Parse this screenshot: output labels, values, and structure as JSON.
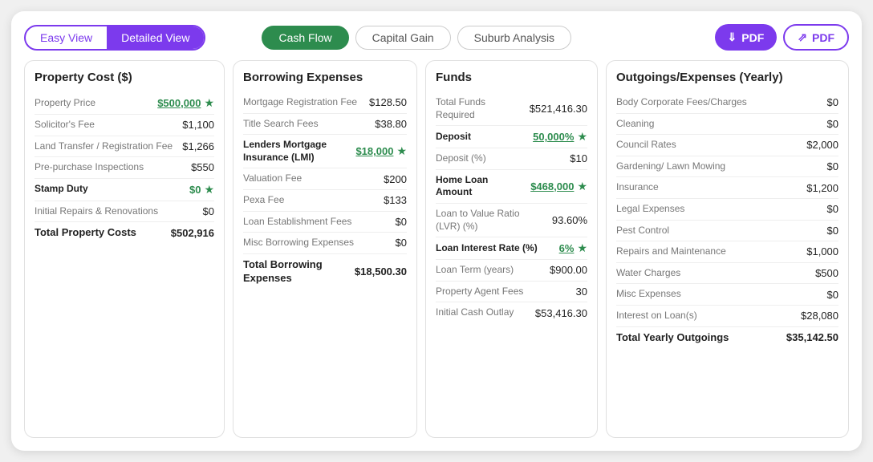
{
  "header": {
    "view_easy": "Easy View",
    "view_detailed": "Detailed View",
    "tab_cashflow": "Cash Flow",
    "tab_capital": "Capital Gain",
    "tab_suburb": "Suburb Analysis",
    "pdf_label1": "PDF",
    "pdf_label2": "PDF"
  },
  "property_cost": {
    "title": "Property Cost ($)",
    "rows": [
      {
        "label": "Property Price",
        "value": "$500,000",
        "style": "green-underline",
        "icon": "star"
      },
      {
        "label": "Solicitor's Fee",
        "value": "$1,100",
        "style": "normal",
        "icon": ""
      },
      {
        "label": "Land Transfer / Registration Fee",
        "value": "$1,266",
        "style": "normal",
        "icon": ""
      },
      {
        "label": "Pre-purchase Inspections",
        "value": "$550",
        "style": "normal",
        "icon": ""
      },
      {
        "label": "Stamp Duty",
        "value": "$0",
        "style": "green",
        "icon": "star"
      },
      {
        "label": "Initial Repairs & Renovations",
        "value": "$0",
        "style": "normal",
        "icon": ""
      }
    ],
    "total_label": "Total Property Costs",
    "total_value": "$502,916"
  },
  "borrowing": {
    "title": "Borrowing Expenses",
    "rows": [
      {
        "label": "Mortgage Registration Fee",
        "value": "$128.50",
        "style": "normal",
        "bold": false
      },
      {
        "label": "Title Search Fees",
        "value": "$38.80",
        "style": "normal",
        "bold": false
      },
      {
        "label": "Lenders Mortgage Insurance (LMI)",
        "value": "$18,000",
        "style": "green-underline",
        "bold": true,
        "icon": "star"
      },
      {
        "label": "Valuation Fee",
        "value": "$200",
        "style": "normal",
        "bold": false
      },
      {
        "label": "Pexa Fee",
        "value": "$133",
        "style": "normal",
        "bold": false
      },
      {
        "label": "Loan Establishment Fees",
        "value": "$0",
        "style": "normal",
        "bold": false
      },
      {
        "label": "Misc Borrowing Expenses",
        "value": "$0",
        "style": "normal",
        "bold": false
      }
    ],
    "total_label": "Total Borrowing Expenses",
    "total_value": "$18,500.30"
  },
  "funds": {
    "title": "Funds",
    "rows": [
      {
        "label": "Total Funds Required",
        "value": "$521,416.30",
        "style": "normal",
        "bold": false
      },
      {
        "label": "Deposit",
        "value": "50,000%",
        "style": "green-underline",
        "bold": true,
        "icon": "star"
      },
      {
        "label": "Deposit (%)",
        "value": "$10",
        "style": "normal",
        "bold": false
      },
      {
        "label": "Home Loan Amount",
        "value": "$468,000",
        "style": "green-underline",
        "bold": true,
        "icon": "star"
      },
      {
        "label": "Loan to Value Ratio (LVR) (%)",
        "value": "93.60%",
        "style": "normal",
        "bold": false
      },
      {
        "label": "Loan Interest Rate (%)",
        "value": "6%",
        "style": "green-underline",
        "bold": true,
        "icon": "star"
      },
      {
        "label": "Loan Term (years)",
        "value": "$900.00",
        "style": "normal",
        "bold": false
      },
      {
        "label": "Property Agent Fees",
        "value": "30",
        "style": "normal",
        "bold": false
      },
      {
        "label": "Initial Cash Outlay",
        "value": "$53,416.30",
        "style": "normal",
        "bold": false
      }
    ]
  },
  "outgoings": {
    "title": "Outgoings/Expenses (Yearly)",
    "rows": [
      {
        "label": "Body Corporate Fees/Charges",
        "value": "$0"
      },
      {
        "label": "Cleaning",
        "value": "$0"
      },
      {
        "label": "Council Rates",
        "value": "$2,000"
      },
      {
        "label": "Gardening/ Lawn Mowing",
        "value": "$0"
      },
      {
        "label": "Insurance",
        "value": "$1,200"
      },
      {
        "label": "Legal Expenses",
        "value": "$0"
      },
      {
        "label": "Pest Control",
        "value": "$0"
      },
      {
        "label": "Repairs and Maintenance",
        "value": "$1,000"
      },
      {
        "label": "Water Charges",
        "value": "$500"
      },
      {
        "label": "Misc Expenses",
        "value": "$0"
      },
      {
        "label": "Interest on Loan(s)",
        "value": "$28,080"
      },
      {
        "label": "Total Yearly Outgoings",
        "value": "$35,142.50"
      }
    ]
  }
}
